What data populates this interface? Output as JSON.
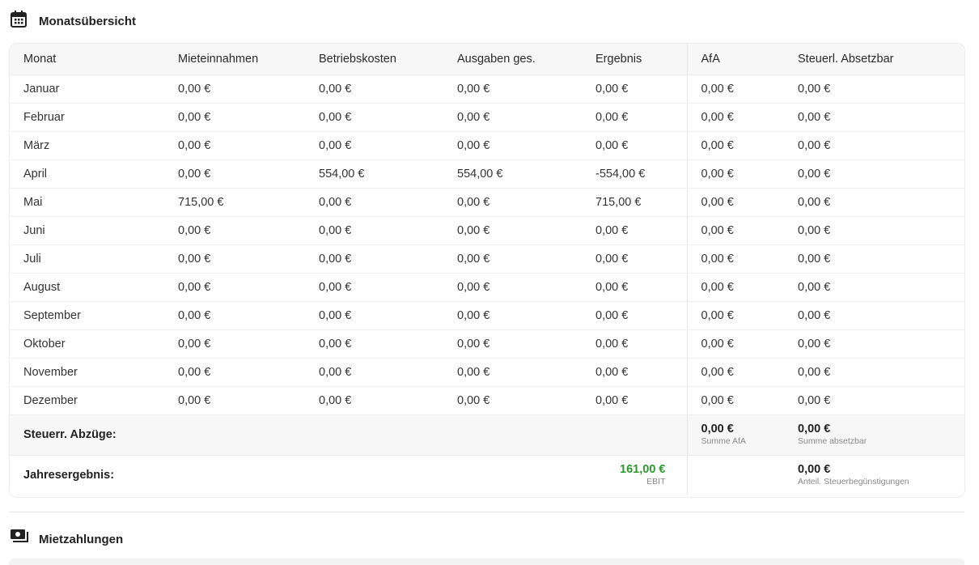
{
  "colors": {
    "ebit_positive": "#2a9a2a",
    "header_bg": "#f7f7f7",
    "border": "#ececec"
  },
  "monthly_overview": {
    "icon": "calendar-icon",
    "title": "Monatsübersicht",
    "columns": [
      "Monat",
      "Mieteinnahmen",
      "Betriebskosten",
      "Ausgaben ges.",
      "Ergebnis",
      "AfA",
      "Steuerl. Absetzbar"
    ],
    "rows": [
      [
        "Januar",
        "0,00 €",
        "0,00 €",
        "0,00 €",
        "0,00 €",
        "0,00 €",
        "0,00 €"
      ],
      [
        "Februar",
        "0,00 €",
        "0,00 €",
        "0,00 €",
        "0,00 €",
        "0,00 €",
        "0,00 €"
      ],
      [
        "März",
        "0,00 €",
        "0,00 €",
        "0,00 €",
        "0,00 €",
        "0,00 €",
        "0,00 €"
      ],
      [
        "April",
        "0,00 €",
        "554,00 €",
        "554,00 €",
        "-554,00 €",
        "0,00 €",
        "0,00 €"
      ],
      [
        "Mai",
        "715,00 €",
        "0,00 €",
        "0,00 €",
        "715,00 €",
        "0,00 €",
        "0,00 €"
      ],
      [
        "Juni",
        "0,00 €",
        "0,00 €",
        "0,00 €",
        "0,00 €",
        "0,00 €",
        "0,00 €"
      ],
      [
        "Juli",
        "0,00 €",
        "0,00 €",
        "0,00 €",
        "0,00 €",
        "0,00 €",
        "0,00 €"
      ],
      [
        "August",
        "0,00 €",
        "0,00 €",
        "0,00 €",
        "0,00 €",
        "0,00 €",
        "0,00 €"
      ],
      [
        "September",
        "0,00 €",
        "0,00 €",
        "0,00 €",
        "0,00 €",
        "0,00 €",
        "0,00 €"
      ],
      [
        "Oktober",
        "0,00 €",
        "0,00 €",
        "0,00 €",
        "0,00 €",
        "0,00 €",
        "0,00 €"
      ],
      [
        "November",
        "0,00 €",
        "0,00 €",
        "0,00 €",
        "0,00 €",
        "0,00 €",
        "0,00 €"
      ],
      [
        "Dezember",
        "0,00 €",
        "0,00 €",
        "0,00 €",
        "0,00 €",
        "0,00 €",
        "0,00 €"
      ]
    ],
    "deductions": {
      "label": "Steuerr. Abzüge:",
      "afa_total": "0,00 €",
      "afa_caption": "Summe AfA",
      "deductible_total": "0,00 €",
      "deductible_caption": "Summe absetzbar"
    },
    "annual_result": {
      "label": "Jahresergebnis:",
      "ebit_value": "161,00 €",
      "ebit_caption": "EBIT",
      "tax_benefit_value": "0,00 €",
      "tax_benefit_caption": "Anteil. Steuerbegünstigungen"
    }
  },
  "rent_payments": {
    "icon": "cash-icon",
    "title": "Mietzahlungen"
  }
}
